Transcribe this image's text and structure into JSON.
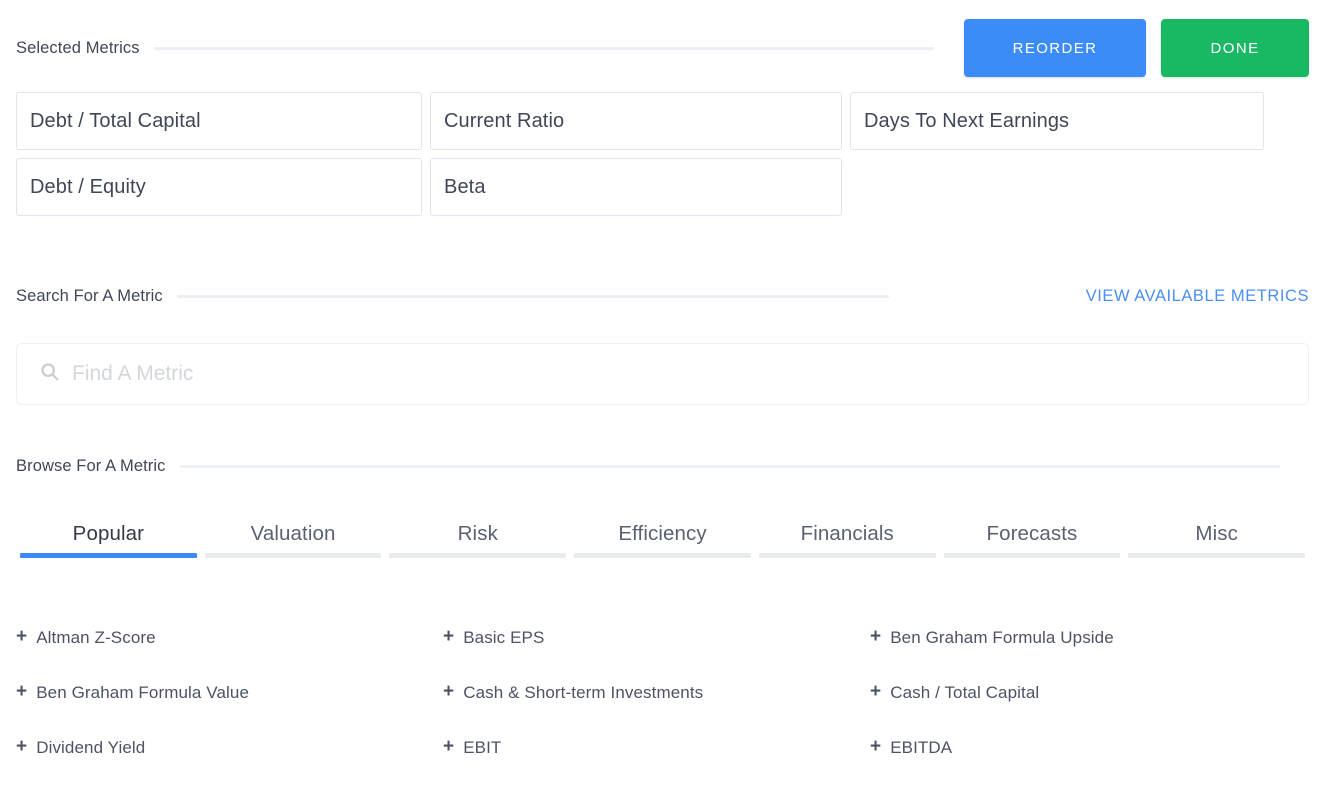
{
  "selected_section": {
    "title": "Selected Metrics",
    "reorder_label": "REORDER",
    "done_label": "DONE",
    "reorder_color": "#3b8cf8",
    "done_color": "#19b862",
    "chips": [
      "Debt / Total Capital",
      "Current Ratio",
      "Days To Next Earnings",
      "Debt / Equity",
      "Beta"
    ]
  },
  "search_section": {
    "title": "Search For A Metric",
    "view_available_label": "VIEW AVAILABLE METRICS",
    "link_color": "#4a90f0",
    "search_icon": "search-icon",
    "input_value": "",
    "input_placeholder": "Find A Metric"
  },
  "browse_section": {
    "title": "Browse For A Metric",
    "active_tab": "Popular",
    "active_tab_color": "#3b8cf8",
    "tabs": [
      {
        "label": "Popular"
      },
      {
        "label": "Valuation"
      },
      {
        "label": "Risk"
      },
      {
        "label": "Efficiency"
      },
      {
        "label": "Financials"
      },
      {
        "label": "Forecasts"
      },
      {
        "label": "Misc"
      }
    ],
    "add_icon": "+",
    "metrics": [
      "Altman Z-Score",
      "Basic EPS",
      "Ben Graham Formula Upside",
      "Ben Graham Formula Value",
      "Cash & Short-term Investments",
      "Cash / Total Capital",
      "Dividend Yield",
      "EBIT",
      "EBITDA"
    ]
  }
}
